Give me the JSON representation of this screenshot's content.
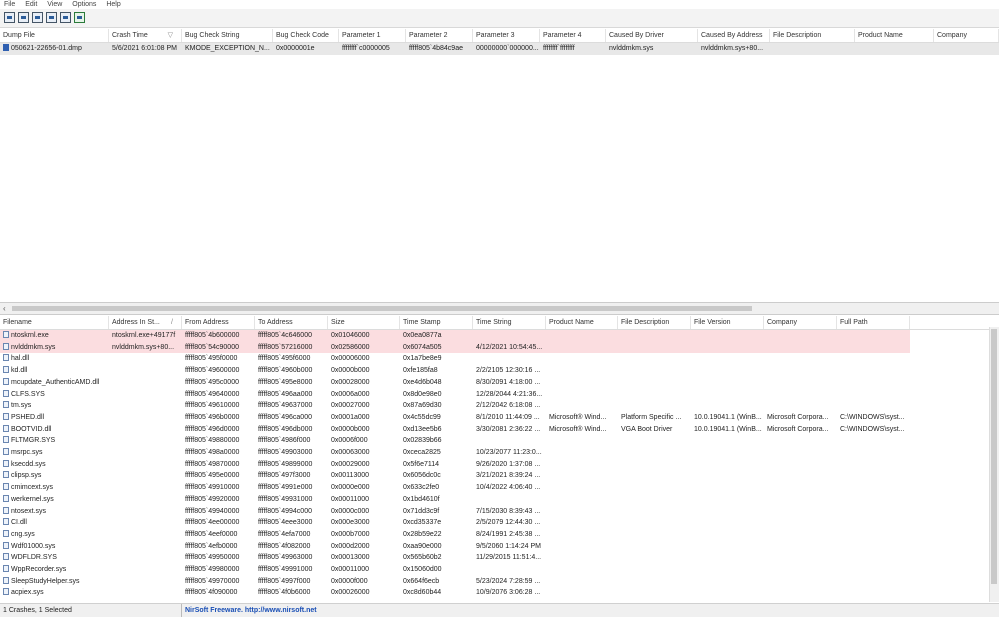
{
  "menu": [
    "File",
    "Edit",
    "View",
    "Options",
    "Help"
  ],
  "toolbar_icons": [
    "save-icon",
    "properties-icon",
    "refresh-icon",
    "copy-icon",
    "folder-icon",
    "exit-icon"
  ],
  "top_columns": [
    "Dump File",
    "Crash Time",
    "Bug Check String",
    "Bug Check Code",
    "Parameter 1",
    "Parameter 2",
    "Parameter 3",
    "Parameter 4",
    "Caused By Driver",
    "Caused By Address",
    "File Description",
    "Product Name",
    "Company"
  ],
  "top_sort_indicator": "▽",
  "top_rows": [
    [
      "050621-22656-01.dmp",
      "5/6/2021 6:01:08 PM",
      "KMODE_EXCEPTION_N...",
      "0x0000001e",
      "ffffffff`c0000005",
      "fffff805`4b84c9ae",
      "00000000`000000...",
      "ffffffff`ffffffff",
      "nvlddmkm.sys",
      "nvlddmkm.sys+80...",
      "",
      "",
      ""
    ]
  ],
  "bottom_columns": [
    "Filename",
    "Address In St...",
    "From Address",
    "To Address",
    "Size",
    "Time Stamp",
    "Time String",
    "Product Name",
    "File Description",
    "File Version",
    "Company",
    "Full Path"
  ],
  "bottom_sort_indicator": "/",
  "bottom_rows": [
    [
      "ntoskrnl.exe",
      "ntoskrnl.exe+49177f",
      "fffff805`4b600000",
      "fffff805`4c646000",
      "0x01046000",
      "0x0ea0877a",
      "",
      "",
      "",
      "",
      "",
      ""
    ],
    [
      "nvlddmkm.sys",
      "nvlddmkm.sys+80...",
      "fffff805`54c90000",
      "fffff805`57216000",
      "0x02586000",
      "0x6074a505",
      "4/12/2021 10:54:45...",
      "",
      "",
      "",
      "",
      ""
    ],
    [
      "hal.dll",
      "",
      "fffff805`495f0000",
      "fffff805`495f6000",
      "0x00006000",
      "0x1a7be8e9",
      "",
      "",
      "",
      "",
      "",
      ""
    ],
    [
      "kd.dll",
      "",
      "fffff805`49600000",
      "fffff805`4960b000",
      "0x0000b000",
      "0xfe185fa8",
      "2/2/2105 12:30:16 ...",
      "",
      "",
      "",
      "",
      ""
    ],
    [
      "mcupdate_AuthenticAMD.dll",
      "",
      "fffff805`495c0000",
      "fffff805`495e8000",
      "0x00028000",
      "0xe4d6b048",
      "8/30/2091 4:18:00 ...",
      "",
      "",
      "",
      "",
      ""
    ],
    [
      "CLFS.SYS",
      "",
      "fffff805`49640000",
      "fffff805`496aa000",
      "0x0006a000",
      "0x8d0e98e0",
      "12/28/2044 4:21:36...",
      "",
      "",
      "",
      "",
      ""
    ],
    [
      "tm.sys",
      "",
      "fffff805`49610000",
      "fffff805`49637000",
      "0x00027000",
      "0x87a69d30",
      "2/12/2042 6:18:08 ...",
      "",
      "",
      "",
      "",
      ""
    ],
    [
      "PSHED.dll",
      "",
      "fffff805`496b0000",
      "fffff805`496ca000",
      "0x0001a000",
      "0x4c55dc99",
      "8/1/2010 11:44:09 ...",
      "Microsoft® Wind...",
      "Platform Specific ...",
      "10.0.19041.1 (WinB...",
      "Microsoft Corpora...",
      "C:\\WINDOWS\\syst..."
    ],
    [
      "BOOTVID.dll",
      "",
      "fffff805`496d0000",
      "fffff805`496db000",
      "0x0000b000",
      "0xd13ee5b6",
      "3/30/2081 2:36:22 ...",
      "Microsoft® Wind...",
      "VGA Boot Driver",
      "10.0.19041.1 (WinB...",
      "Microsoft Corpora...",
      "C:\\WINDOWS\\syst..."
    ],
    [
      "FLTMGR.SYS",
      "",
      "fffff805`49880000",
      "fffff805`4986f000",
      "0x0006f000",
      "0x02839b66",
      "",
      "",
      "",
      "",
      "",
      ""
    ],
    [
      "msrpc.sys",
      "",
      "fffff805`498a0000",
      "fffff805`49903000",
      "0x00063000",
      "0xceca2825",
      "10/23/2077 11:23:0...",
      "",
      "",
      "",
      "",
      ""
    ],
    [
      "ksecdd.sys",
      "",
      "fffff805`49870000",
      "fffff805`49899000",
      "0x00029000",
      "0x5f6e7114",
      "9/26/2020 1:37:08 ...",
      "",
      "",
      "",
      "",
      ""
    ],
    [
      "clipsp.sys",
      "",
      "fffff805`495e0000",
      "fffff805`497f3000",
      "0x00113000",
      "0x6056dc0c",
      "3/21/2021 8:39:24 ...",
      "",
      "",
      "",
      "",
      ""
    ],
    [
      "cmimcext.sys",
      "",
      "fffff805`49910000",
      "fffff805`4991e000",
      "0x0000e000",
      "0x633c2fe0",
      "10/4/2022 4:06:40 ...",
      "",
      "",
      "",
      "",
      ""
    ],
    [
      "werkernel.sys",
      "",
      "fffff805`49920000",
      "fffff805`49931000",
      "0x00011000",
      "0x1bd4610f",
      "",
      "",
      "",
      "",
      "",
      ""
    ],
    [
      "ntosext.sys",
      "",
      "fffff805`49940000",
      "fffff805`4994c000",
      "0x0000c000",
      "0x71dd3c9f",
      "7/15/2030 8:39:43 ...",
      "",
      "",
      "",
      "",
      ""
    ],
    [
      "CI.dll",
      "",
      "fffff805`4ee00000",
      "fffff805`4eee3000",
      "0x000e3000",
      "0xcd35337e",
      "2/5/2079 12:44:30 ...",
      "",
      "",
      "",
      "",
      ""
    ],
    [
      "cng.sys",
      "",
      "fffff805`4eef0000",
      "fffff805`4efa7000",
      "0x000b7000",
      "0x28b59e22",
      "8/24/1991 2:45:38 ...",
      "",
      "",
      "",
      "",
      ""
    ],
    [
      "Wdf01000.sys",
      "",
      "fffff805`4efb0000",
      "fffff805`4f082000",
      "0x000d2000",
      "0xaa90e000",
      "9/5/2060 1:14:24 PM",
      "",
      "",
      "",
      "",
      ""
    ],
    [
      "WDFLDR.SYS",
      "",
      "fffff805`49950000",
      "fffff805`49963000",
      "0x00013000",
      "0x565b60b2",
      "11/29/2015 11:51:4...",
      "",
      "",
      "",
      "",
      ""
    ],
    [
      "WppRecorder.sys",
      "",
      "fffff805`49980000",
      "fffff805`49991000",
      "0x00011000",
      "0x15060d00",
      "",
      "",
      "",
      "",
      "",
      ""
    ],
    [
      "SleepStudyHelper.sys",
      "",
      "fffff805`49970000",
      "fffff805`4997f000",
      "0x0000f000",
      "0x664f6ecb",
      "5/23/2024 7:28:59 ...",
      "",
      "",
      "",
      "",
      ""
    ],
    [
      "acpiex.sys",
      "",
      "fffff805`4f090000",
      "fffff805`4f0b6000",
      "0x00026000",
      "0xc8d60b44",
      "10/9/2076 3:06:28 ...",
      "",
      "",
      "",
      "",
      ""
    ]
  ],
  "status": {
    "count": "1 Crashes, 1 Selected",
    "freeware": "NirSoft Freeware.  http://www.nirsoft.net"
  }
}
